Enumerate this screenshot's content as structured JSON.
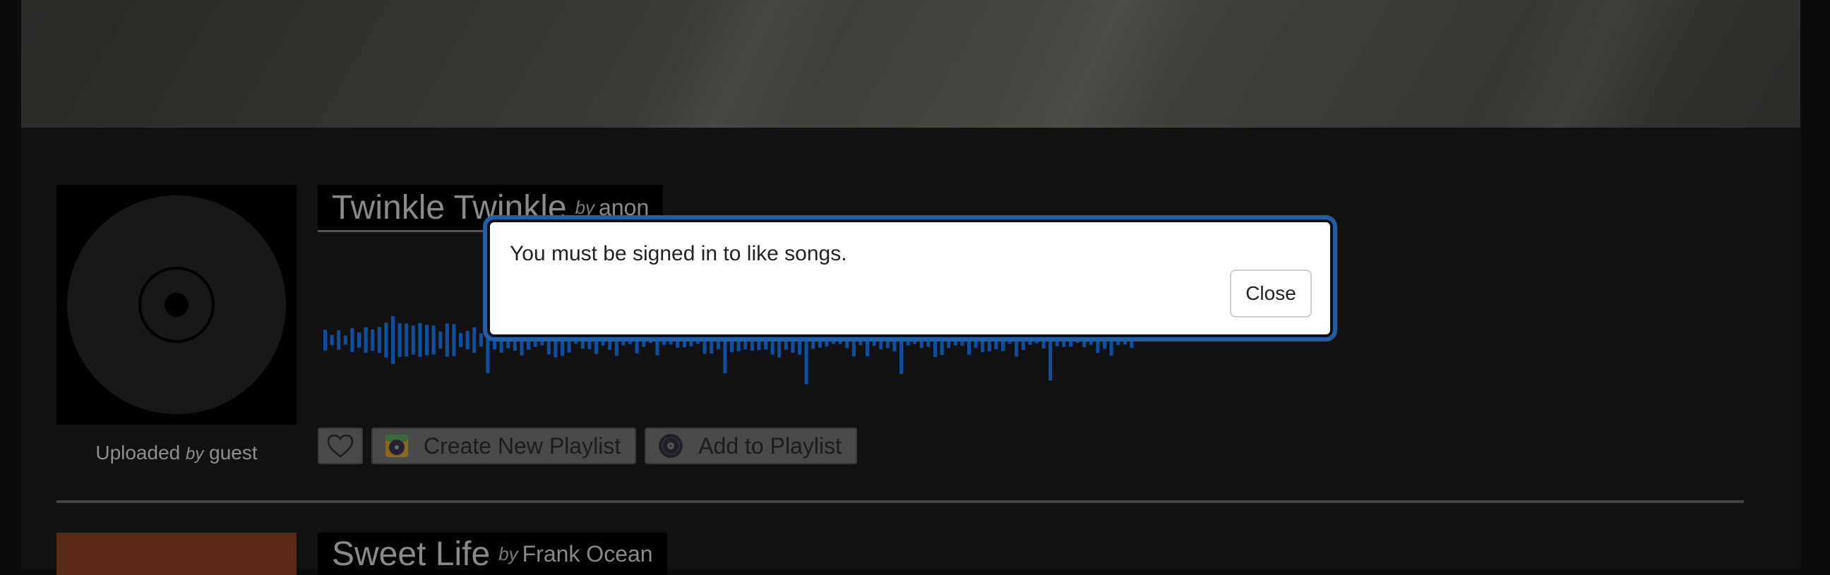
{
  "songs": [
    {
      "title": "Twinkle Twinkle",
      "by": "by",
      "artist": "anon",
      "uploaded_prefix": "Uploaded",
      "uploaded_by": "by",
      "uploader": "guest",
      "actions": {
        "like_icon": "heart-outline-icon",
        "create_playlist_label": "Create New Playlist",
        "create_playlist_icon": "playlist-disc-icon",
        "add_to_playlist_label": "Add to Playlist",
        "add_to_playlist_icon": "vinyl-disc-icon"
      }
    },
    {
      "title": "Sweet Life",
      "by": "by",
      "artist": "Frank Ocean"
    }
  ],
  "modal": {
    "message": "You must be signed in to like songs.",
    "close_label": "Close"
  },
  "colors": {
    "waveform": "#0f4fa0",
    "modal_focus_ring": "#1f5fa8",
    "artwork_orange": "#5a2a14"
  }
}
